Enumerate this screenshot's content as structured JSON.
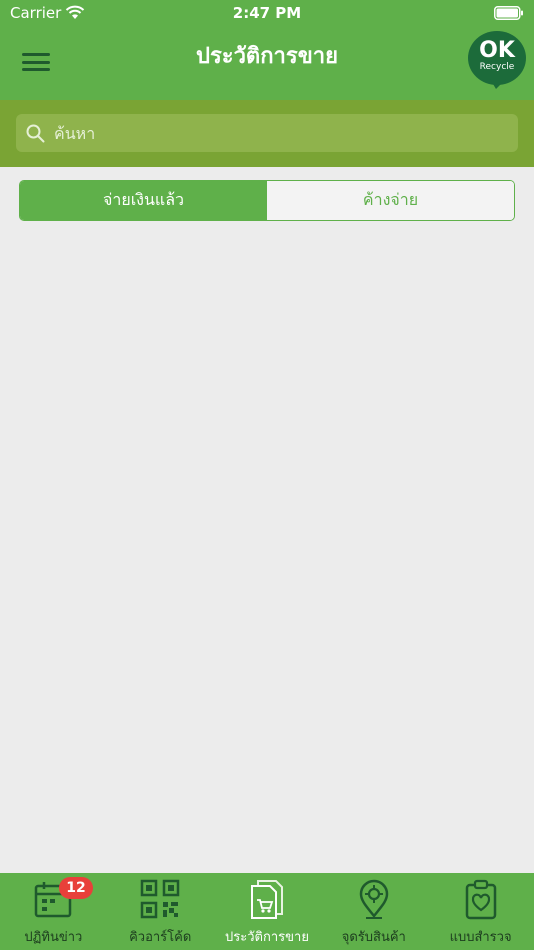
{
  "status_bar": {
    "carrier": "Carrier",
    "time": "2:47 PM"
  },
  "nav": {
    "title": "ประวัติการขาย",
    "logo_main": "OK",
    "logo_sub": "Recycle"
  },
  "search": {
    "placeholder": "ค้นหา",
    "value": ""
  },
  "segments": [
    {
      "label": "จ่ายเงินแล้ว",
      "selected": true
    },
    {
      "label": "ค้างจ่าย",
      "selected": false
    }
  ],
  "tabs": [
    {
      "label": "ปฏิทินข่าว",
      "icon": "calendar-icon",
      "badge": "12"
    },
    {
      "label": "คิวอาร์โค้ด",
      "icon": "qr-code-icon"
    },
    {
      "label": "ประวัติการขาย",
      "icon": "sales-history-icon",
      "selected": true
    },
    {
      "label": "จุดรับสินค้า",
      "icon": "location-pin-icon"
    },
    {
      "label": "แบบสำรวจ",
      "icon": "clipboard-heart-icon"
    }
  ],
  "colors": {
    "primary_green": "#5fb04a",
    "search_band": "#7aa434",
    "icon_dark": "#1f5a2d",
    "badge_red": "#e8403a",
    "logo_green": "#1c6b3a"
  }
}
